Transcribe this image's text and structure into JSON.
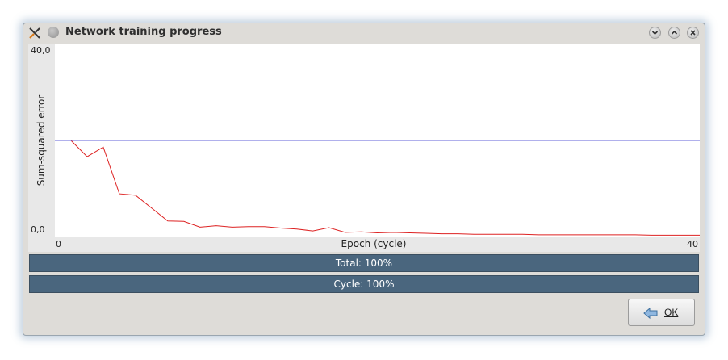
{
  "window": {
    "title": "Network training progress",
    "icons": {
      "app": "kde-logo-icon",
      "sticky": "on-all-desktops-icon",
      "minimize": "minimize-icon",
      "maximize": "maximize-icon",
      "close": "close-icon"
    }
  },
  "chart_data": {
    "type": "line",
    "ylabel": "Sum-squared error",
    "xlabel": "Epoch (cycle)",
    "ylim": [
      0,
      40
    ],
    "xlim": [
      0,
      40
    ],
    "y_tick_labels": [
      "40,0",
      "0,0"
    ],
    "x_tick_labels": [
      "0",
      "40"
    ],
    "grid": false,
    "series": [
      {
        "color": "#dd2222",
        "x": [
          0,
          1,
          2,
          3,
          4,
          5,
          6,
          7,
          8,
          9,
          10,
          11,
          12,
          13,
          14,
          15,
          16,
          17,
          18,
          19,
          20,
          21,
          22,
          23,
          24,
          25,
          26,
          27,
          28,
          29,
          30,
          31,
          32,
          33,
          34,
          35,
          36,
          37,
          38,
          39,
          40
        ],
        "y": [
          20.0,
          20.0,
          16.6,
          18.6,
          8.8,
          8.5,
          5.8,
          3.1,
          3.0,
          1.8,
          2.1,
          1.8,
          1.9,
          1.9,
          1.6,
          1.4,
          1.0,
          1.7,
          0.7,
          0.8,
          0.6,
          0.7,
          0.6,
          0.5,
          0.4,
          0.4,
          0.3,
          0.3,
          0.3,
          0.3,
          0.2,
          0.2,
          0.2,
          0.2,
          0.2,
          0.2,
          0.2,
          0.1,
          0.1,
          0.1,
          0.1
        ]
      },
      {
        "color": "#6060d8",
        "x": [
          0,
          40
        ],
        "y": [
          20.0,
          20.0
        ]
      }
    ]
  },
  "progress": {
    "total": {
      "text": "Total: 100%",
      "value": 1.0
    },
    "cycle": {
      "text": "Cycle: 100%",
      "value": 1.0
    }
  },
  "buttons": {
    "ok_label": "OK",
    "ok_icon": "back-arrow-icon"
  }
}
